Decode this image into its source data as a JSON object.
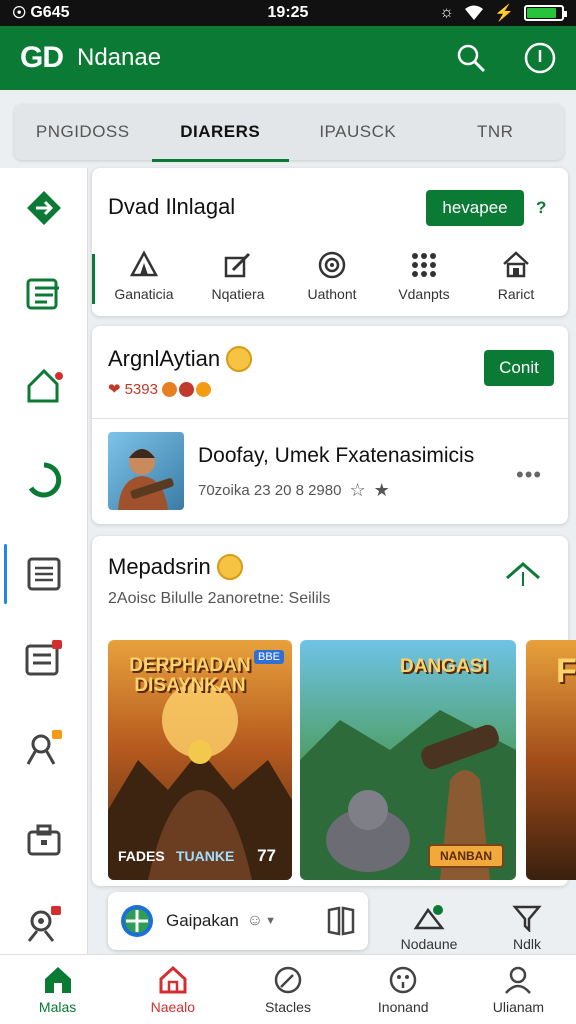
{
  "status": {
    "carrier": "G645",
    "time": "19:25",
    "battery_level": 0.85
  },
  "appbar": {
    "logo": "GD",
    "title": "Ndanae",
    "search_icon": "search-icon",
    "info_icon": "info-icon"
  },
  "tabs": [
    {
      "label": "PNGIDOSS",
      "active": false
    },
    {
      "label": "DIARERS",
      "active": true
    },
    {
      "label": "IPAUSCK",
      "active": false
    },
    {
      "label": "TNR",
      "active": false
    }
  ],
  "sidebar": {
    "items": [
      "arrow-right-icon",
      "list-icon",
      "home-icon",
      "refresh-icon",
      "document-icon",
      "inbox-icon",
      "person-icon",
      "briefcase-icon",
      "user-gear-icon"
    ]
  },
  "card1": {
    "title": "Dvad Ilnlagal",
    "button": "hevapee",
    "help": "?",
    "quick": [
      {
        "label": "Ganaticia",
        "icon": "tent-icon"
      },
      {
        "label": "Nqatiera",
        "icon": "edit-icon"
      },
      {
        "label": "Uathont",
        "icon": "target-icon"
      },
      {
        "label": "Vdanpts",
        "icon": "grid-icon"
      },
      {
        "label": "Rarict",
        "icon": "house-icon"
      }
    ]
  },
  "card2": {
    "title": "ArgnlAytian",
    "meta": "5393",
    "button": "Conit",
    "item_title": "Doofay, Umek Fxatenasimicis",
    "item_meta": "70zoika  23 20  8 2980",
    "more": "•••"
  },
  "card3": {
    "title": "Mepadsrin",
    "subtitle": "2Aoisc Bilulle  2anoretne: Seilils",
    "games": [
      {
        "title": "DERPHADAN DISAYNKAN",
        "badge": "BBE",
        "footer_left": "FADES",
        "footer_mid": "TUANKE",
        "footer_right": "77"
      },
      {
        "title": "DANGASI",
        "footer_right": "NANBAN"
      },
      {
        "title": "F"
      }
    ]
  },
  "bottom_toolbar": {
    "chip": "Gaipakan",
    "actions": [
      {
        "label": "Nodaune",
        "icon": "edit-icon"
      },
      {
        "label": "Ndlk",
        "icon": "funnel-icon"
      }
    ]
  },
  "nav": [
    {
      "label": "Malas",
      "icon": "home-icon"
    },
    {
      "label": "Naealo",
      "icon": "home-outline-icon"
    },
    {
      "label": "Stacles",
      "icon": "leaf-icon"
    },
    {
      "label": "Inonand",
      "icon": "face-icon"
    },
    {
      "label": "Ulianam",
      "icon": "person-icon"
    }
  ],
  "colors": {
    "brand": "#0b7a34",
    "alert": "#d32f2f",
    "accent": "#1e88e5"
  }
}
